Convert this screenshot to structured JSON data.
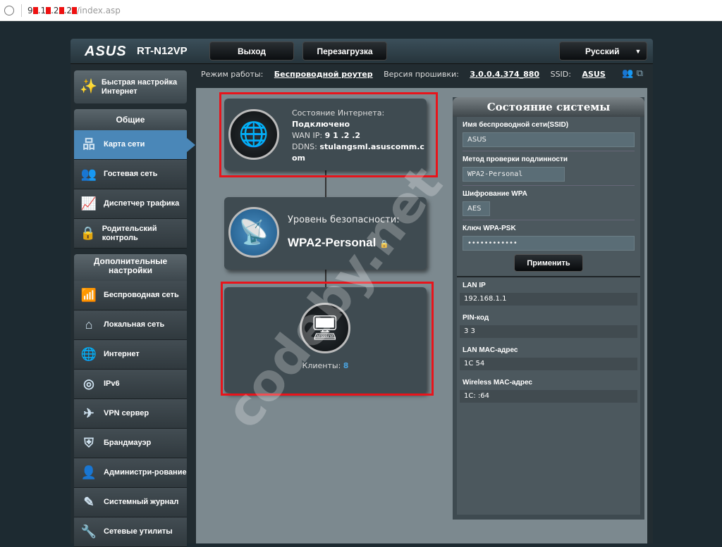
{
  "browser": {
    "url_prefix": "9",
    "url_parts": [
      ".1",
      ".2",
      ".2"
    ],
    "url_path": "/index.asp"
  },
  "header": {
    "brand": "ASUS",
    "model": "RT-N12VP",
    "logout": "Выход",
    "reboot": "Перезагрузка",
    "language": "Русский"
  },
  "info": {
    "mode_label": "Режим работы:",
    "mode": "Беспроводной роутер",
    "fw_label": "Версия прошивки:",
    "fw": "3.0.0.4.374_880",
    "ssid_label": "SSID:",
    "ssid": "ASUS"
  },
  "sidebar": {
    "quick_setup": "Быстрая настройка Интернет",
    "general": "Общие",
    "general_items": [
      {
        "label": "Карта сети",
        "icon": "network-map-icon",
        "g": "品"
      },
      {
        "label": "Гостевая сеть",
        "icon": "guest-network-icon",
        "g": "👥"
      },
      {
        "label": "Диспетчер трафика",
        "icon": "traffic-icon",
        "g": "📈"
      },
      {
        "label": "Родительский контроль",
        "icon": "lock-icon",
        "g": "🔒"
      }
    ],
    "advanced": "Дополнительные настройки",
    "advanced_items": [
      {
        "label": "Беспроводная сеть",
        "icon": "wifi-icon",
        "g": "📶"
      },
      {
        "label": "Локальная сеть",
        "icon": "home-icon",
        "g": "⌂"
      },
      {
        "label": "Интернет",
        "icon": "globe-icon",
        "g": "🌐"
      },
      {
        "label": "IPv6",
        "icon": "ipv6-icon",
        "g": "◎"
      },
      {
        "label": "VPN сервер",
        "icon": "vpn-icon",
        "g": "✈"
      },
      {
        "label": "Брандмауэр",
        "icon": "shield-icon",
        "g": "⛨"
      },
      {
        "label": "Администри-рование",
        "icon": "admin-icon",
        "g": "👤"
      },
      {
        "label": "Системный журнал",
        "icon": "log-icon",
        "g": "✎"
      },
      {
        "label": "Сетевые утилиты",
        "icon": "tools-icon",
        "g": "🔧"
      }
    ]
  },
  "internet": {
    "title": "Состояние Интернета:",
    "status": "Подключено",
    "wan_label": "WAN IP:",
    "wan_value": "9 1 .2 .2",
    "ddns_label": "DDNS:",
    "ddns_value": "stulangsml.asuscomm.com"
  },
  "security": {
    "title": "Уровень безопасности:",
    "value": "WPA2-Personal"
  },
  "clients": {
    "label": "Клиенты:",
    "count": "8"
  },
  "system": {
    "title": "Состояние системы",
    "ssid_label": "Имя беспроводной сети(SSID)",
    "ssid": "ASUS",
    "auth_label": "Метод проверки подлинности",
    "auth": "WPA2-Personal",
    "enc_label": "Шифрование WPA",
    "enc": "AES",
    "key_label": "Ключ WPA-PSK",
    "key": "••••••••••••",
    "apply": "Применить",
    "lan_ip_label": "LAN IP",
    "lan_ip": "192.168.1.1",
    "pin_label": "PIN-код",
    "pin": "3        3",
    "lan_mac_label": "LAN MAC-адрес",
    "lan_mac": "1C              54",
    "wmac_label": "Wireless MAC-адрес",
    "wmac": "1C:              :64"
  },
  "watermark": "codeby.net"
}
